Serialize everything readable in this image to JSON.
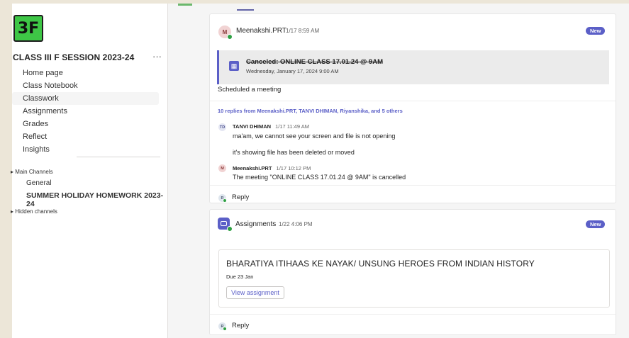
{
  "team": {
    "logo_text": "3F",
    "name": "CLASS III F SESSION 2023-24",
    "more": "···"
  },
  "nav": [
    "Home page",
    "Class Notebook",
    "Classwork",
    "Assignments",
    "Grades",
    "Reflect",
    "Insights"
  ],
  "channels": {
    "main_title": "Main Channels",
    "general": "General",
    "summer": "SUMMER HOLIDAY HOMEWORK 2023-24",
    "hidden_title": "Hidden channels"
  },
  "post1": {
    "avatar": "M",
    "author": "Meenakshi.PRT",
    "time": "1/17 8:59 AM",
    "badge": "New",
    "meeting_title": "Canceled: ONLINE CLASS 17.01.24 @ 9AM",
    "meeting_date": "Wednesday, January 17, 2024 9:00 AM",
    "text": "Scheduled a meeting",
    "replies_summary": "10 replies from Meenakshi.PRT, TANVI DHIMAN, Riyanshika, and 5 others",
    "reply1": {
      "avatar": "TD",
      "author": "TANVI DHIMAN",
      "time": "1/17 11:49 AM",
      "line1": "ma'am, we cannot see your screen and file is not opening",
      "line2": "it's showing file has been deleted or moved"
    },
    "reply2": {
      "avatar": "M",
      "author": "Meenakshi.PRT",
      "time": "1/17 10:12 PM",
      "text": "The meeting \"ONLINE CLASS 17.01.24 @ 9AM\" is cancelled"
    },
    "reply_label": "Reply",
    "reply_avatar": "R"
  },
  "post2": {
    "author": "Assignments",
    "time": "1/22 4:06 PM",
    "badge": "New",
    "assignment_title": "BHARATIYA ITIHAAS KE NAYAK/ UNSUNG HEROES FROM INDIAN HISTORY",
    "due": "Due 23 Jan",
    "view_button": "View assignment",
    "reply_label": "Reply",
    "reply_avatar": "R"
  },
  "colors": {
    "accent": "#5b5fc7",
    "logo_green": "#3ec646",
    "online": "#2ea043"
  }
}
